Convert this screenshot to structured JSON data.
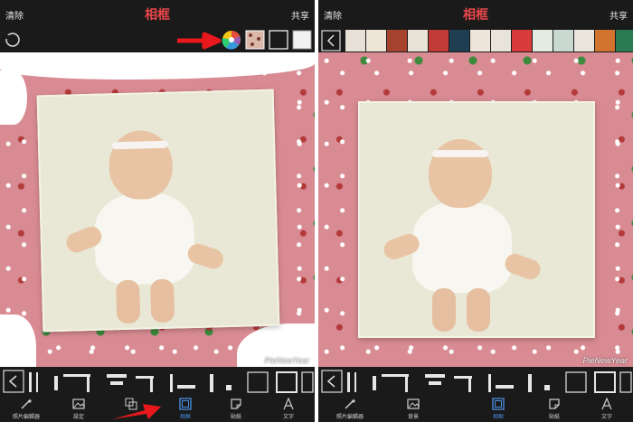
{
  "left": {
    "topbar": {
      "clear": "清除",
      "title": "相框",
      "share": "共享"
    },
    "watermark": "PieNewYear",
    "tools": [
      {
        "label": "照片編輯器",
        "icon": "magic-wand-icon",
        "active": false
      },
      {
        "label": "設定",
        "icon": "photo-settings-icon",
        "active": false
      },
      {
        "label": "",
        "icon": "layout-icon",
        "active": false
      },
      {
        "label": "相框",
        "icon": "frame-icon",
        "active": true
      },
      {
        "label": "貼紙",
        "icon": "sticker-icon",
        "active": false
      },
      {
        "label": "文字",
        "icon": "text-icon",
        "active": false
      }
    ]
  },
  "right": {
    "topbar": {
      "clear": "清除",
      "title": "相框",
      "share": "共享"
    },
    "watermark": "PieNewYear",
    "tools": [
      {
        "label": "照片編輯器",
        "icon": "magic-wand-icon",
        "active": false
      },
      {
        "label": "背景",
        "icon": "background-icon",
        "active": false
      },
      {
        "label": "相框",
        "icon": "frame-icon",
        "active": true
      },
      {
        "label": "貼紙",
        "icon": "sticker-icon",
        "active": false
      },
      {
        "label": "文字",
        "icon": "text-icon",
        "active": false
      }
    ]
  },
  "colors": {
    "title": "#e8474a",
    "active": "#4a90e2",
    "arrow": "#e8181d"
  }
}
